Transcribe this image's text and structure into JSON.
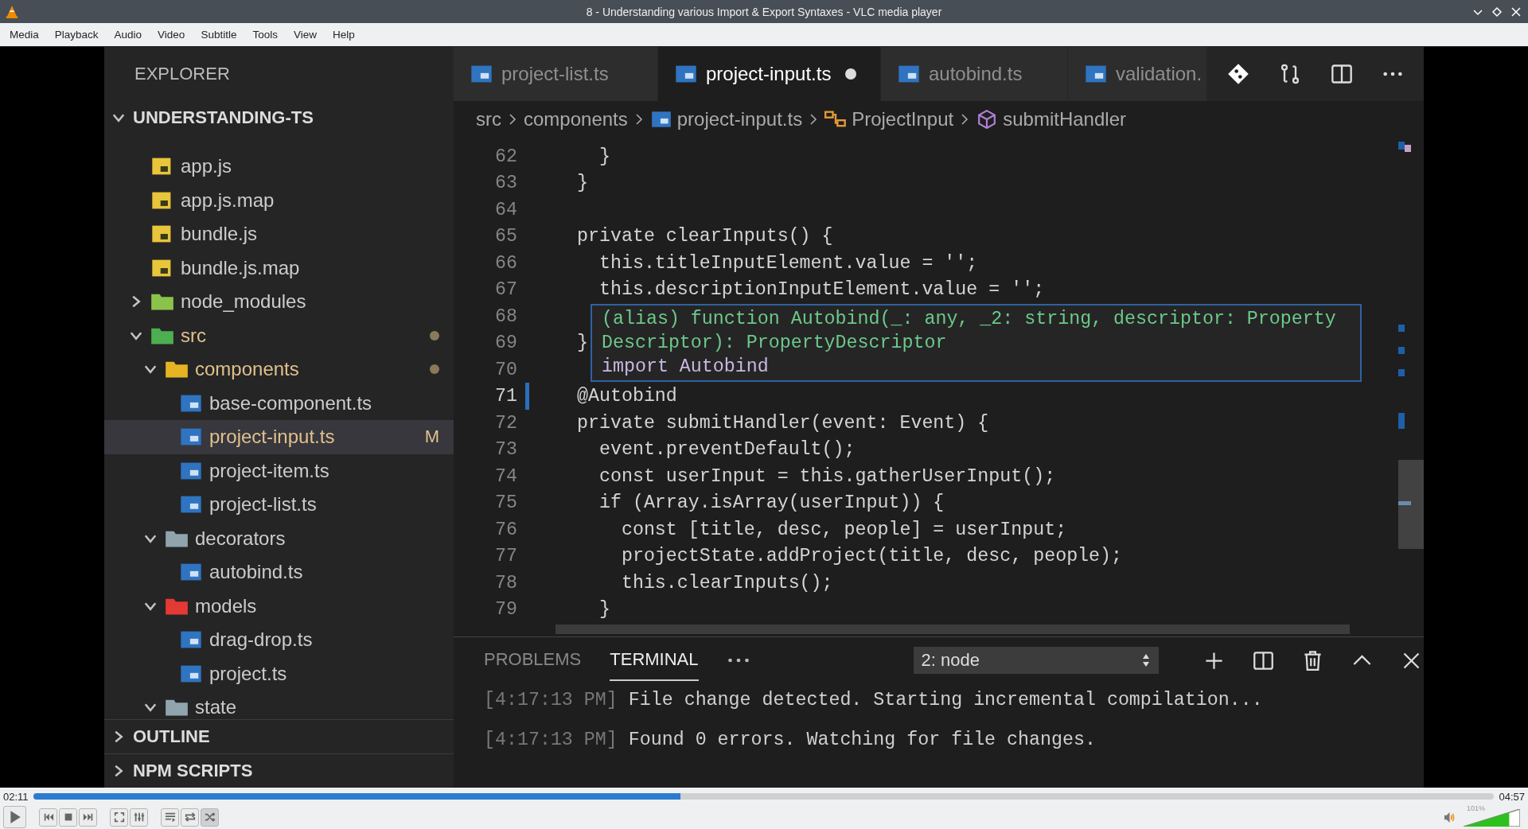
{
  "window": {
    "title": "8 - Understanding various Import & Export Syntaxes - VLC media player"
  },
  "menu": [
    "Media",
    "Playback",
    "Audio",
    "Video",
    "Subtitle",
    "Tools",
    "View",
    "Help"
  ],
  "video": {
    "sidebar": {
      "title": "EXPLORER",
      "project": {
        "label": "UNDERSTANDING-TS",
        "expanded": true
      },
      "tree": [
        {
          "label": "app.js",
          "kind": "js",
          "selected": false,
          "modified": false
        },
        {
          "label": "app.js.map",
          "kind": "js",
          "selected": false,
          "modified": false
        },
        {
          "label": "bundle.js",
          "kind": "js",
          "selected": false,
          "modified": false
        },
        {
          "label": "bundle.js.map",
          "kind": "js",
          "selected": false,
          "modified": false
        },
        {
          "label": "node_modules",
          "kind": "folder",
          "color": "#8bc34a",
          "expanded": false,
          "selected": false,
          "modified": false
        },
        {
          "label": "src",
          "kind": "folder",
          "color": "#4caf50",
          "expanded": true,
          "selected": false,
          "modified": true,
          "children": [
            {
              "label": "components",
              "kind": "folder",
              "color": "#e6b422",
              "expanded": true,
              "selected": false,
              "modified": true,
              "children": [
                {
                  "label": "base-component.ts",
                  "kind": "ts",
                  "selected": false,
                  "modified": false
                },
                {
                  "label": "project-input.ts",
                  "kind": "ts",
                  "selected": true,
                  "modified": true,
                  "badge": "M"
                },
                {
                  "label": "project-item.ts",
                  "kind": "ts",
                  "selected": false,
                  "modified": false
                },
                {
                  "label": "project-list.ts",
                  "kind": "ts",
                  "selected": false,
                  "modified": false
                }
              ]
            },
            {
              "label": "decorators",
              "kind": "folder",
              "color": "#90a4ae",
              "expanded": true,
              "selected": false,
              "modified": false,
              "children": [
                {
                  "label": "autobind.ts",
                  "kind": "ts",
                  "selected": false,
                  "modified": false
                }
              ]
            },
            {
              "label": "models",
              "kind": "folder",
              "color": "#e53935",
              "expanded": true,
              "selected": false,
              "modified": false,
              "children": [
                {
                  "label": "drag-drop.ts",
                  "kind": "ts",
                  "selected": false,
                  "modified": false
                },
                {
                  "label": "project.ts",
                  "kind": "ts",
                  "selected": false,
                  "modified": false
                }
              ]
            },
            {
              "label": "state",
              "kind": "folder",
              "color": "#90a4ae",
              "expanded": true,
              "selected": false,
              "modified": false
            }
          ]
        }
      ],
      "sections": [
        {
          "label": "OUTLINE",
          "expanded": false
        },
        {
          "label": "NPM SCRIPTS",
          "expanded": false
        }
      ]
    },
    "editor": {
      "tabs": [
        {
          "label": "project-list.ts",
          "selected": false,
          "dirty": false
        },
        {
          "label": "project-input.ts",
          "selected": true,
          "dirty": true
        },
        {
          "label": "autobind.ts",
          "selected": false,
          "dirty": false
        },
        {
          "label": "validation.",
          "selected": false,
          "dirty": false
        }
      ],
      "breadcrumb": [
        {
          "label": "src",
          "kind": "folder"
        },
        {
          "label": "components",
          "kind": "folder"
        },
        {
          "label": "project-input.ts",
          "kind": "file"
        },
        {
          "label": "ProjectInput",
          "kind": "class"
        },
        {
          "label": "submitHandler",
          "kind": "method"
        }
      ],
      "lines": [
        {
          "number": "62",
          "text": "  }",
          "current": false
        },
        {
          "number": "63",
          "text": "}",
          "current": false
        },
        {
          "number": "64",
          "current": false
        },
        {
          "number": "65",
          "text": "private clearInputs() {",
          "current": false
        },
        {
          "number": "66",
          "text": "  this.titleInputElement.value = '';",
          "current": false
        },
        {
          "number": "67",
          "text": "  this.descriptionInputElement.value = '';",
          "current": false
        },
        {
          "number": "68",
          "current": false
        },
        {
          "number": "69",
          "text": "}",
          "current": false
        },
        {
          "number": "70",
          "current": false
        },
        {
          "number": "71",
          "text": "@Autobind",
          "current": true
        },
        {
          "number": "72",
          "text": "private submitHandler(event: Event) {",
          "current": false
        },
        {
          "number": "73",
          "text": "  event.preventDefault();",
          "current": false
        },
        {
          "number": "74",
          "text": "  const userInput = this.gatherUserInput();",
          "current": false
        },
        {
          "number": "75",
          "text": "  if (Array.isArray(userInput)) {",
          "current": false
        },
        {
          "number": "76",
          "text": "    const [title, desc, people] = userInput;",
          "current": false
        },
        {
          "number": "77",
          "text": "    projectState.addProject(title, desc, people);",
          "current": false
        },
        {
          "number": "78",
          "text": "    this.clearInputs();",
          "current": false
        },
        {
          "number": "79",
          "text": "  }",
          "current": false
        }
      ],
      "hover": {
        "signature": "(alias) function Autobind(_: any, _2: string, descriptor: PropertyDescriptor): PropertyDescriptor",
        "import": "import Autobind"
      }
    },
    "panel": {
      "tabs": [
        {
          "label": "PROBLEMS",
          "selected": false
        },
        {
          "label": "TERMINAL",
          "selected": true
        }
      ],
      "terminal_select": "2: node",
      "output": [
        {
          "time": "[4:17:13 PM]",
          "message": "File change detected. Starting incremental compilation..."
        },
        {
          "time": "[4:17:13 PM]",
          "message": "Found 0 errors. Watching for file changes."
        }
      ]
    }
  },
  "player": {
    "elapsed": "02:11",
    "position": {
      "level": 0.443
    },
    "duration": "04:57",
    "random": {
      "on": true
    },
    "volume": {
      "label": "101%",
      "level": 0.808
    }
  }
}
